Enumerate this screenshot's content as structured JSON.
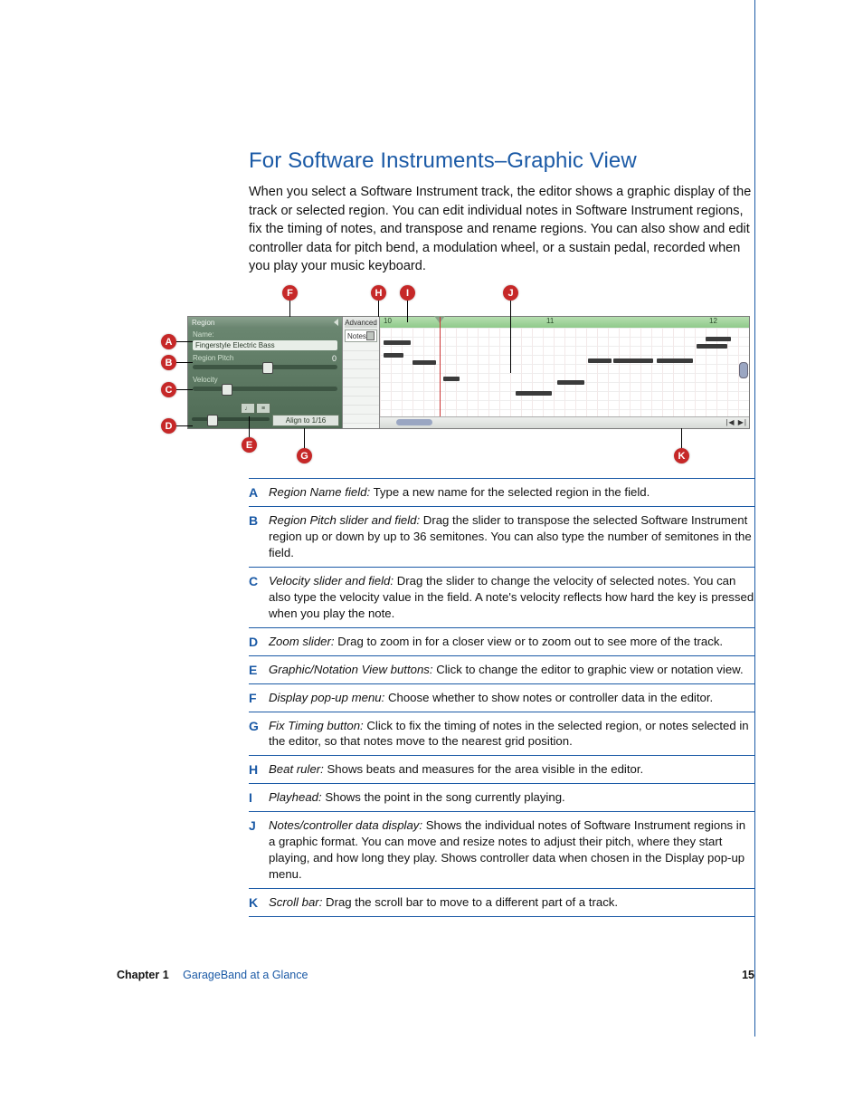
{
  "heading": "For Software Instruments–Graphic View",
  "intro": "When you select a Software Instrument track, the editor shows a graphic display of the track or selected region. You can edit individual notes in Software Instrument regions, fix the timing of notes, and transpose and rename regions. You can also show and edit controller data for pitch bend, a modulation wheel, or a sustain pedal, recorded when you play your music keyboard.",
  "screenshot": {
    "sidebar_header": "Region",
    "advanced_label": "Advanced",
    "name_label": "Name:",
    "name_value": "Fingerstyle Electric Bass",
    "region_pitch_label": "Region Pitch",
    "region_pitch_value": "0",
    "velocity_label": "Velocity",
    "notes_menu": "Notes",
    "align_label": "Align to 1/16",
    "ruler_marks": [
      "10",
      "11",
      "12"
    ],
    "scroll_arrows": "|◀ ▶|"
  },
  "callouts": [
    "A",
    "B",
    "C",
    "D",
    "E",
    "F",
    "G",
    "H",
    "I",
    "J",
    "K"
  ],
  "legend": [
    {
      "letter": "A",
      "term": "Region Name field:",
      "text": " Type a new name for the selected region in the field."
    },
    {
      "letter": "B",
      "term": "Region Pitch slider and field:",
      "text": " Drag the slider to transpose the selected Software Instrument region up or down by up to 36 semitones. You can also type the number of semitones in the field."
    },
    {
      "letter": "C",
      "term": "Velocity slider and field:",
      "text": " Drag the slider to change the velocity of selected notes. You can also type the velocity value in the field. A note's velocity reflects how hard the key is pressed when you play the note."
    },
    {
      "letter": "D",
      "term": "Zoom slider:",
      "text": " Drag to zoom in for a closer view or to zoom out to see more of the track."
    },
    {
      "letter": "E",
      "term": "Graphic/Notation View buttons:",
      "text": " Click to change the editor to graphic view or notation view."
    },
    {
      "letter": "F",
      "term": "Display pop-up menu:",
      "text": " Choose whether to show notes or controller data in the editor."
    },
    {
      "letter": "G",
      "term": "Fix Timing button:",
      "text": " Click to fix the timing of notes in the selected region, or notes selected in the editor, so that notes move to the nearest grid position."
    },
    {
      "letter": "H",
      "term": "Beat ruler:",
      "text": " Shows beats and measures for the area visible in the editor."
    },
    {
      "letter": "I",
      "term": "Playhead:",
      "text": " Shows the point in the song currently playing."
    },
    {
      "letter": "J",
      "term": "Notes/controller data display:",
      "text": " Shows the individual notes of Software Instrument regions in a graphic format. You can move and resize notes to adjust their pitch, where they start playing, and how long they play. Shows controller data when chosen in the Display pop-up menu."
    },
    {
      "letter": "K",
      "term": "Scroll bar:",
      "text": " Drag the scroll bar to move to a different part of a track."
    }
  ],
  "footer": {
    "chapter_label": "Chapter 1",
    "chapter_title": "GarageBand at a Glance",
    "page_number": "15"
  }
}
